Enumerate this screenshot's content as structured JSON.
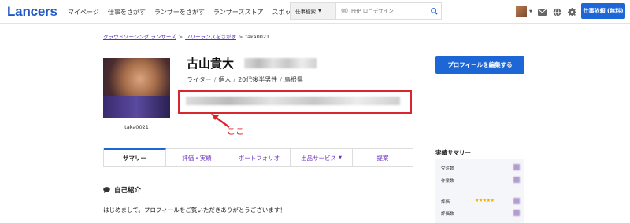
{
  "header": {
    "logo": "Lancers",
    "nav": [
      "マイページ",
      "仕事をさがす",
      "ランサーをさがす",
      "ランサーズストア",
      "スポット常駐"
    ],
    "search_category": "仕事検索",
    "search_placeholder": "例）PHP ロゴデザイン",
    "request_button": "仕事依頼 (無料)"
  },
  "breadcrumb": [
    "クラウドソーシング ランサーズ",
    "フリーランスをさがす",
    "taka0021"
  ],
  "profile": {
    "name": "古山貴大",
    "occupation": "ライター",
    "type": "個人",
    "age_gender": "20代後半男性",
    "location": "島根県",
    "username": "taka0021",
    "annotation": "ここ",
    "edit_button": "プロフィールを編集する"
  },
  "tabs": [
    "サマリー",
    "評価・実績",
    "ポートフォリオ",
    "出品サービス",
    "提案"
  ],
  "self_intro": {
    "title": "自己紹介",
    "text": "はじめまして。プロフィールをご覧いただきありがとうございます！"
  },
  "summary": {
    "title": "実績サマリー",
    "rows": [
      "受注数",
      "作業数",
      "評価",
      "評価数"
    ],
    "rating_stars": "★★★★★"
  },
  "colors": {
    "brand": "#1f5ac7",
    "button": "#1d66d6",
    "highlight": "#d8262e",
    "tab_text": "#6a2fbf"
  }
}
